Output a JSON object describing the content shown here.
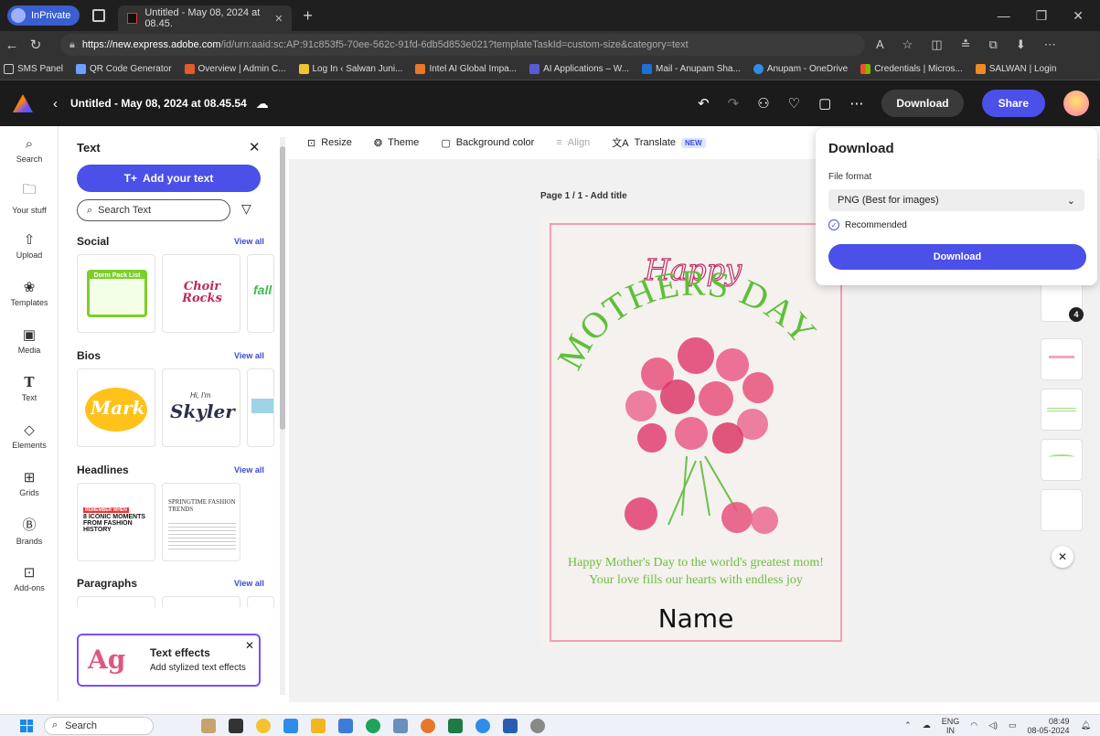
{
  "browser": {
    "inprivate_label": "InPrivate",
    "tab_title": "Untitled - May 08, 2024 at 08.45.",
    "url_host": "https://new.express.adobe.com",
    "url_path": "/id/urn:aaid:sc:AP:91c853f5-70ee-562c-91fd-6db5d853e021?templateTaskId=custom-size&category=text",
    "bookmarks": [
      "SMS Panel",
      "QR Code Generator",
      "Overview | Admin C...",
      "Log In ‹ Salwan Juni...",
      "Intel AI Global Impa...",
      "AI Applications – W...",
      "Mail - Anupam Sha...",
      "Anupam - OneDrive",
      "Credentials | Micros...",
      "SALWAN | Login"
    ]
  },
  "app_header": {
    "doc_title": "Untitled - May 08, 2024 at 08.45.54",
    "download_label": "Download",
    "share_label": "Share"
  },
  "rail": [
    {
      "label": "Search",
      "icon": "search-icon"
    },
    {
      "label": "Your stuff",
      "icon": "folder-icon"
    },
    {
      "label": "Upload",
      "icon": "upload-icon"
    },
    {
      "label": "Templates",
      "icon": "templates-icon"
    },
    {
      "label": "Media",
      "icon": "media-icon"
    },
    {
      "label": "Text",
      "icon": "text-icon"
    },
    {
      "label": "Elements",
      "icon": "elements-icon"
    },
    {
      "label": "Grids",
      "icon": "grids-icon"
    },
    {
      "label": "Brands",
      "icon": "brands-icon"
    },
    {
      "label": "Add-ons",
      "icon": "addons-icon"
    }
  ],
  "panel": {
    "title": "Text",
    "add_text_label": "Add your text",
    "search_placeholder": "Search Text",
    "sections": [
      {
        "title": "Social",
        "view_all": "View all"
      },
      {
        "title": "Bios",
        "view_all": "View all"
      },
      {
        "title": "Headlines",
        "view_all": "View all"
      },
      {
        "title": "Paragraphs",
        "view_all": "View all"
      }
    ],
    "social_thumb_1": "Dorm Pack List",
    "social_thumb_2": "Choir Rocks",
    "social_thumb_3": "fall",
    "bios_thumb_1": "Mark",
    "bios_thumb_2_small": "Hi, I'm",
    "bios_thumb_2": "Skyler",
    "headline_thumb_1_tag": "REMEMBER WHEN",
    "headline_thumb_1": "8 ICONIC MOMENTS FROM FASHION HISTORY",
    "headline_thumb_2": "SPRINGTIME FASHION TRENDS",
    "text_effects": {
      "glyph": "Ag",
      "title": "Text effects",
      "subtitle": "Add stylized text effects"
    }
  },
  "toolbar": {
    "resize": "Resize",
    "theme": "Theme",
    "background_color": "Background color",
    "align": "Align",
    "translate": "Translate",
    "new_badge": "NEW"
  },
  "canvas": {
    "page_label": "Page 1 / 1 - Add title",
    "happy": "Happy",
    "mothers_day": "MOTHERS DAY",
    "message": "Happy Mother's Day to the world's greatest mom! Your love fills our hearts with endless joy",
    "name": "Name"
  },
  "pages_badge": "4",
  "download_popover": {
    "title": "Download",
    "file_format_label": "File format",
    "selected_format": "PNG (Best for images)",
    "recommended_label": "Recommended",
    "download_button": "Download"
  },
  "taskbar": {
    "search_label": "Search",
    "lang_1": "ENG",
    "lang_2": "IN",
    "time": "08:49",
    "date": "08-05-2024"
  },
  "colors": {
    "accent": "#4a50e8",
    "header_bg": "#1b1b1b",
    "card_green": "#6cbf3d",
    "card_border": "#f0a0b0"
  }
}
